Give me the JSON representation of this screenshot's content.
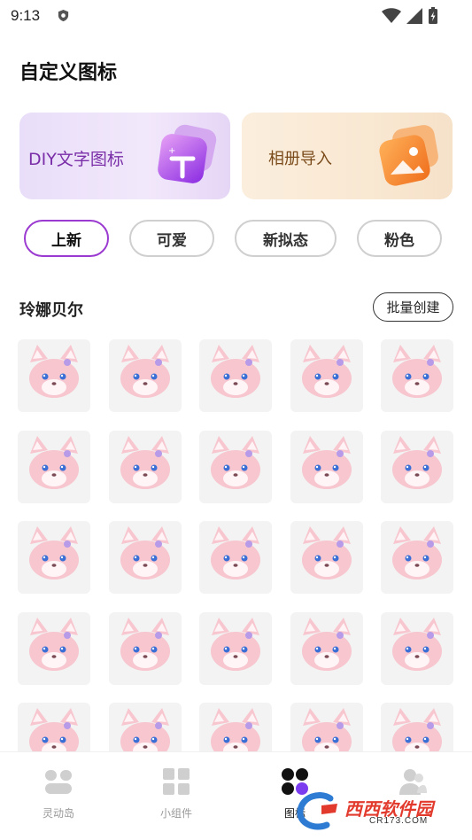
{
  "status_bar": {
    "time": "9:13"
  },
  "header": {
    "title": "自定义图标"
  },
  "banners": [
    {
      "label": "DIY文字图标",
      "accent": "#9b3ad0"
    },
    {
      "label": "相册导入",
      "accent": "#f08a2a"
    }
  ],
  "categories": [
    {
      "label": "上新",
      "selected": true
    },
    {
      "label": "可爱",
      "selected": false
    },
    {
      "label": "新拟态",
      "selected": false
    },
    {
      "label": "粉色",
      "selected": false
    }
  ],
  "section": {
    "title": "玲娜贝尔",
    "batch_label": "批量创建"
  },
  "icons": [
    "book-icon",
    "pen-icon",
    "clock-icon",
    "netease-music-icon",
    "alipay-icon",
    "qq-icon",
    "iqiyi-icon",
    "bilibili-icon",
    "douyin-icon",
    "wechat-icon",
    "notes-icon",
    "radio-icon",
    "game-icon",
    "rifle-icon",
    "weather-icon",
    "mango-tv-icon",
    "tencent-video-icon",
    "kuaishou-icon",
    "photo-icon",
    "memo-icon",
    "bird-icon",
    "calendar-icon",
    "camera-icon",
    "calculator-icon",
    "settings-icon"
  ],
  "bottom_nav": [
    {
      "label": "灵动岛",
      "icon": "dynamic-island-icon",
      "active": false
    },
    {
      "label": "小组件",
      "icon": "widgets-icon",
      "active": false
    },
    {
      "label": "图标",
      "icon": "icons-tab-icon",
      "active": true
    },
    {
      "label": "",
      "icon": "profile-icon",
      "active": false
    }
  ],
  "watermark": {
    "brand": "西西软件园",
    "url": "CR173.COM"
  },
  "colors": {
    "accent": "#9b3ad0",
    "fox_pink": "#f7c6cf",
    "tile_bg": "#f3f3f3"
  }
}
